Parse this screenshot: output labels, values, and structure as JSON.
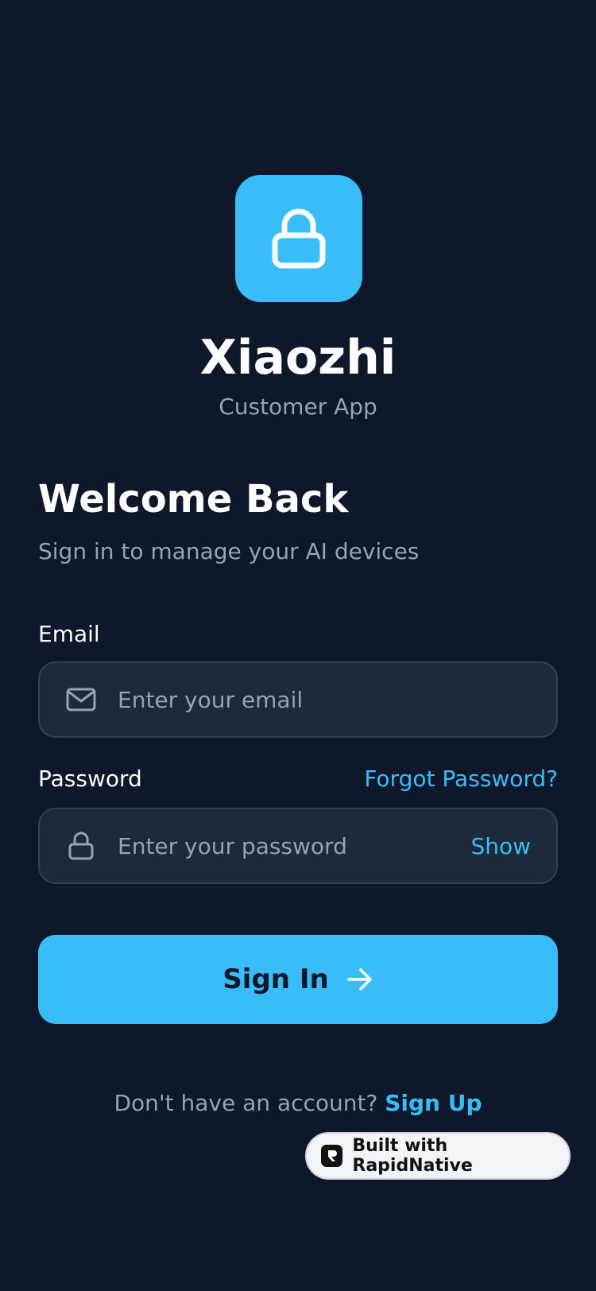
{
  "brand": {
    "name": "Xiaozhi",
    "subtitle": "Customer App",
    "accent_color": "#38bdf8",
    "background_color": "#0f172a",
    "logo_icon": "lock-icon"
  },
  "heading": {
    "title": "Welcome Back",
    "subtitle": "Sign in to manage your AI devices"
  },
  "form": {
    "email": {
      "label": "Email",
      "placeholder": "Enter your email",
      "value": "",
      "icon": "mail-icon"
    },
    "password": {
      "label": "Password",
      "placeholder": "Enter your password",
      "value": "",
      "icon": "lock-icon",
      "toggle_label": "Show",
      "forgot_label": "Forgot Password?"
    },
    "submit_label": "Sign In",
    "submit_icon": "arrow-right-icon"
  },
  "footer": {
    "prompt": "Don't have an account?",
    "link": "Sign Up"
  },
  "badge": {
    "label": "Built with RapidNative",
    "icon": "rapidnative-logo-icon"
  }
}
